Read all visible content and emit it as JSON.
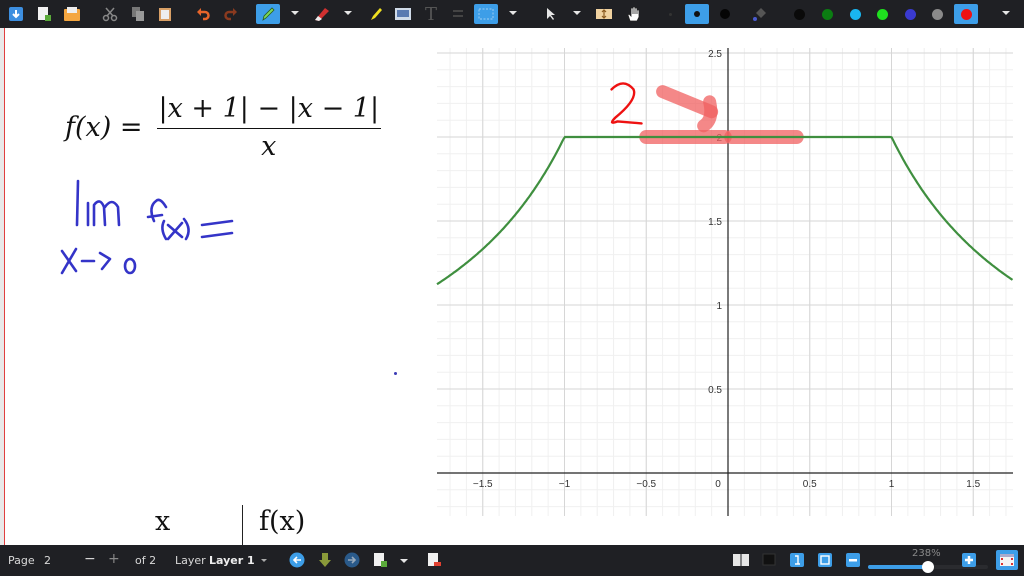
{
  "toolbar": {
    "tools": [
      {
        "name": "save",
        "icon": "save-icon"
      },
      {
        "name": "new-page",
        "icon": "new-page-icon"
      },
      {
        "name": "open",
        "icon": "open-folder-icon"
      },
      {
        "name": "cut",
        "icon": "scissors-icon"
      },
      {
        "name": "copy",
        "icon": "copy-icon"
      },
      {
        "name": "paste",
        "icon": "paste-icon"
      },
      {
        "name": "undo",
        "icon": "undo-icon"
      },
      {
        "name": "redo",
        "icon": "redo-icon"
      },
      {
        "name": "pen",
        "icon": "pen-icon",
        "active": true
      },
      {
        "name": "eraser",
        "icon": "eraser-icon"
      },
      {
        "name": "highlighter",
        "icon": "highlighter-icon"
      },
      {
        "name": "image",
        "icon": "image-icon"
      },
      {
        "name": "text",
        "icon": "text-icon",
        "glyph": "T"
      },
      {
        "name": "math",
        "icon": "math-icon"
      },
      {
        "name": "select-region",
        "icon": "select-rect-icon",
        "active": true
      },
      {
        "name": "select-object",
        "icon": "pointer-icon"
      },
      {
        "name": "vertical-space",
        "icon": "vertical-space-icon"
      },
      {
        "name": "hand",
        "icon": "hand-icon"
      }
    ],
    "pen_sizes": [
      "fine",
      "medium",
      "thick"
    ],
    "colors": [
      {
        "name": "black",
        "hex": "#0a0a0a"
      },
      {
        "name": "dark-green",
        "hex": "#0b7d12"
      },
      {
        "name": "light-blue",
        "hex": "#19b6f0"
      },
      {
        "name": "green",
        "hex": "#1fe01f"
      },
      {
        "name": "blue",
        "hex": "#3a3ad0"
      },
      {
        "name": "gray",
        "hex": "#8a8a8a"
      },
      {
        "name": "red",
        "hex": "#ee1111",
        "active": true
      }
    ]
  },
  "canvas": {
    "formula": {
      "lhs": "f(x) =",
      "numerator": "|x + 1| − |x − 1|",
      "denominator": "x"
    },
    "handwriting": {
      "limit_top": "lim",
      "limit_sub": "x→0",
      "limit_expr": "f(x) =",
      "answer": "2"
    },
    "table_header": {
      "col1": "x",
      "col2": "f(x)"
    }
  },
  "chart_data": {
    "type": "line",
    "title": "",
    "xlabel": "",
    "ylabel": "",
    "function": "f(x) = (|x+1| - |x-1|)/x",
    "xlim": [
      -1.78,
      1.74
    ],
    "ylim": [
      -0.25,
      2.55
    ],
    "x_ticks": [
      -1.5,
      -1,
      -0.5,
      0,
      0.5,
      1,
      1.5
    ],
    "x_tick_labels": [
      "−1.5",
      "−1",
      "−0.5",
      "0",
      "0.5",
      "1",
      "1.5"
    ],
    "y_ticks": [
      0.5,
      1,
      1.5,
      2,
      2.5
    ],
    "y_tick_labels": [
      "0.5",
      "1",
      "1.5",
      "2",
      "2.5"
    ],
    "grid": true,
    "series": [
      {
        "name": "f(x)",
        "color": "#3f8f3f",
        "x": [
          -1.78,
          -1.5,
          -1.25,
          -1.0,
          -0.5,
          0,
          0.5,
          1.0,
          1.25,
          1.5,
          1.74
        ],
        "y": [
          1.124,
          1.333,
          1.6,
          2.0,
          2.0,
          2.0,
          2.0,
          2.0,
          1.6,
          1.333,
          1.149
        ]
      }
    ],
    "annotations": [
      {
        "type": "highlight-segment",
        "x": [
          -0.5,
          -0.02
        ],
        "y": 2,
        "color": "#f06060"
      },
      {
        "type": "highlight-segment",
        "x": [
          0.02,
          0.42
        ],
        "y": 2,
        "color": "#f06060"
      },
      {
        "type": "arrow",
        "from": [
          -0.4,
          2.27
        ],
        "to": [
          -0.1,
          2.15
        ],
        "color": "#f06060"
      },
      {
        "type": "handwritten-text",
        "text": "2",
        "at": [
          -0.7,
          2.2
        ],
        "color": "#ee1111"
      }
    ]
  },
  "statusbar": {
    "page_label": "Page",
    "page_value": "2",
    "minus": "−",
    "plus": "+",
    "of_pages": "of 2",
    "layer_label": "Layer",
    "layer_value": "Layer 1",
    "zoom_label": "238%",
    "zoom_fraction": 0.5
  }
}
